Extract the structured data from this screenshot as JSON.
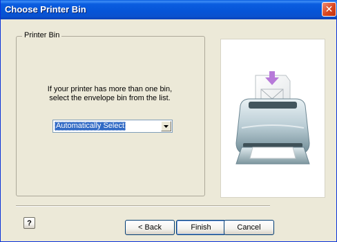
{
  "window": {
    "title": "Choose Printer Bin",
    "close_glyph": "✕"
  },
  "group": {
    "legend": "Printer Bin",
    "instructions_line1": "If your printer has more than one bin,",
    "instructions_line2": "select the envelope bin from the list."
  },
  "bin_select": {
    "selected": "Automatically Select"
  },
  "illustration": {
    "icon": "printer-with-envelope-icon"
  },
  "footer": {
    "help_label": "?",
    "back_label": "< Back",
    "finish_label": "Finish",
    "cancel_label": "Cancel"
  },
  "colors": {
    "titlebar": "#0654d7",
    "dialog_bg": "#ece9d8",
    "selection": "#316ac5",
    "close_button": "#d9461f",
    "envelope_arrow": "#b77ad9"
  }
}
